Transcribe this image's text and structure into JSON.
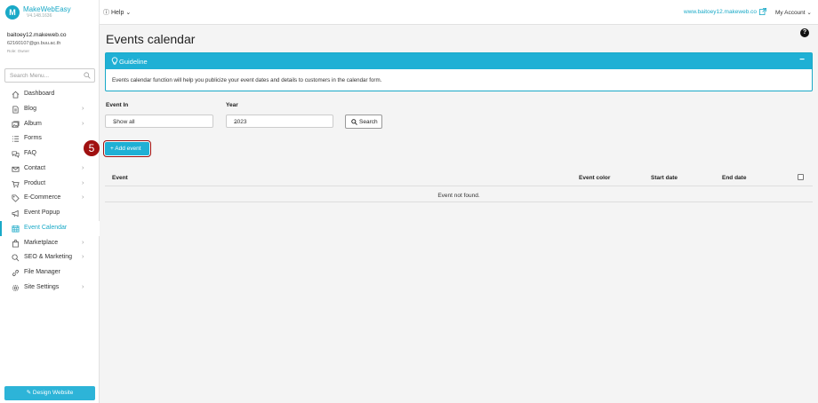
{
  "brand": {
    "name": "MakeWebEasy",
    "version": "V4.148.1636"
  },
  "topbar": {
    "help_label": "Help",
    "site_link": "www.baitoey12.makeweb.co",
    "account_label": "My Account"
  },
  "user": {
    "name": "baitoey12.makeweb.co",
    "email": "62160107@go.buu.ac.th",
    "role": "Role: Owner"
  },
  "sidebar": {
    "search_placeholder": "Search Menu...",
    "items": [
      {
        "label": "Dashboard",
        "icon": "home-icon",
        "chevron": ""
      },
      {
        "label": "Blog",
        "icon": "document-icon",
        "chevron": "›"
      },
      {
        "label": "Album",
        "icon": "images-icon",
        "chevron": "›"
      },
      {
        "label": "Forms",
        "icon": "list-icon",
        "chevron": ""
      },
      {
        "label": "FAQ",
        "icon": "faq-icon",
        "chevron": ""
      },
      {
        "label": "Contact",
        "icon": "envelope-icon",
        "chevron": "›"
      },
      {
        "label": "Product",
        "icon": "cart-icon",
        "chevron": "›"
      },
      {
        "label": "E-Commerce",
        "icon": "tag-icon",
        "chevron": "›"
      },
      {
        "label": "Event Popup",
        "icon": "megaphone-icon",
        "chevron": ""
      },
      {
        "label": "Event Calendar",
        "icon": "calendar-icon",
        "chevron": "",
        "active": true
      },
      {
        "label": "Marketplace",
        "icon": "bag-icon",
        "chevron": "›"
      },
      {
        "label": "SEO & Marketing",
        "icon": "magnifier-icon",
        "chevron": "›"
      },
      {
        "label": "File Manager",
        "icon": "link-icon",
        "chevron": ""
      },
      {
        "label": "Site Settings",
        "icon": "gear-icon",
        "chevron": "›"
      }
    ],
    "design_button": "Design Website"
  },
  "main": {
    "title": "Events calendar",
    "guideline": {
      "title": "Guideline",
      "text": "Events calendar function will help you publicize your event dates and details to customers in the calendar form."
    },
    "filters": {
      "event_in_label": "Event In",
      "event_in_value": "Show all",
      "year_label": "Year",
      "year_value": "2023",
      "search_button": "Search"
    },
    "add_button": "+ Add event",
    "step_marker": "5",
    "table": {
      "columns": [
        "Event",
        "Event color",
        "Start date",
        "End date"
      ],
      "empty_text": "Event not found."
    }
  },
  "colors": {
    "accent": "#1fb0d5",
    "marker": "#a01010"
  }
}
